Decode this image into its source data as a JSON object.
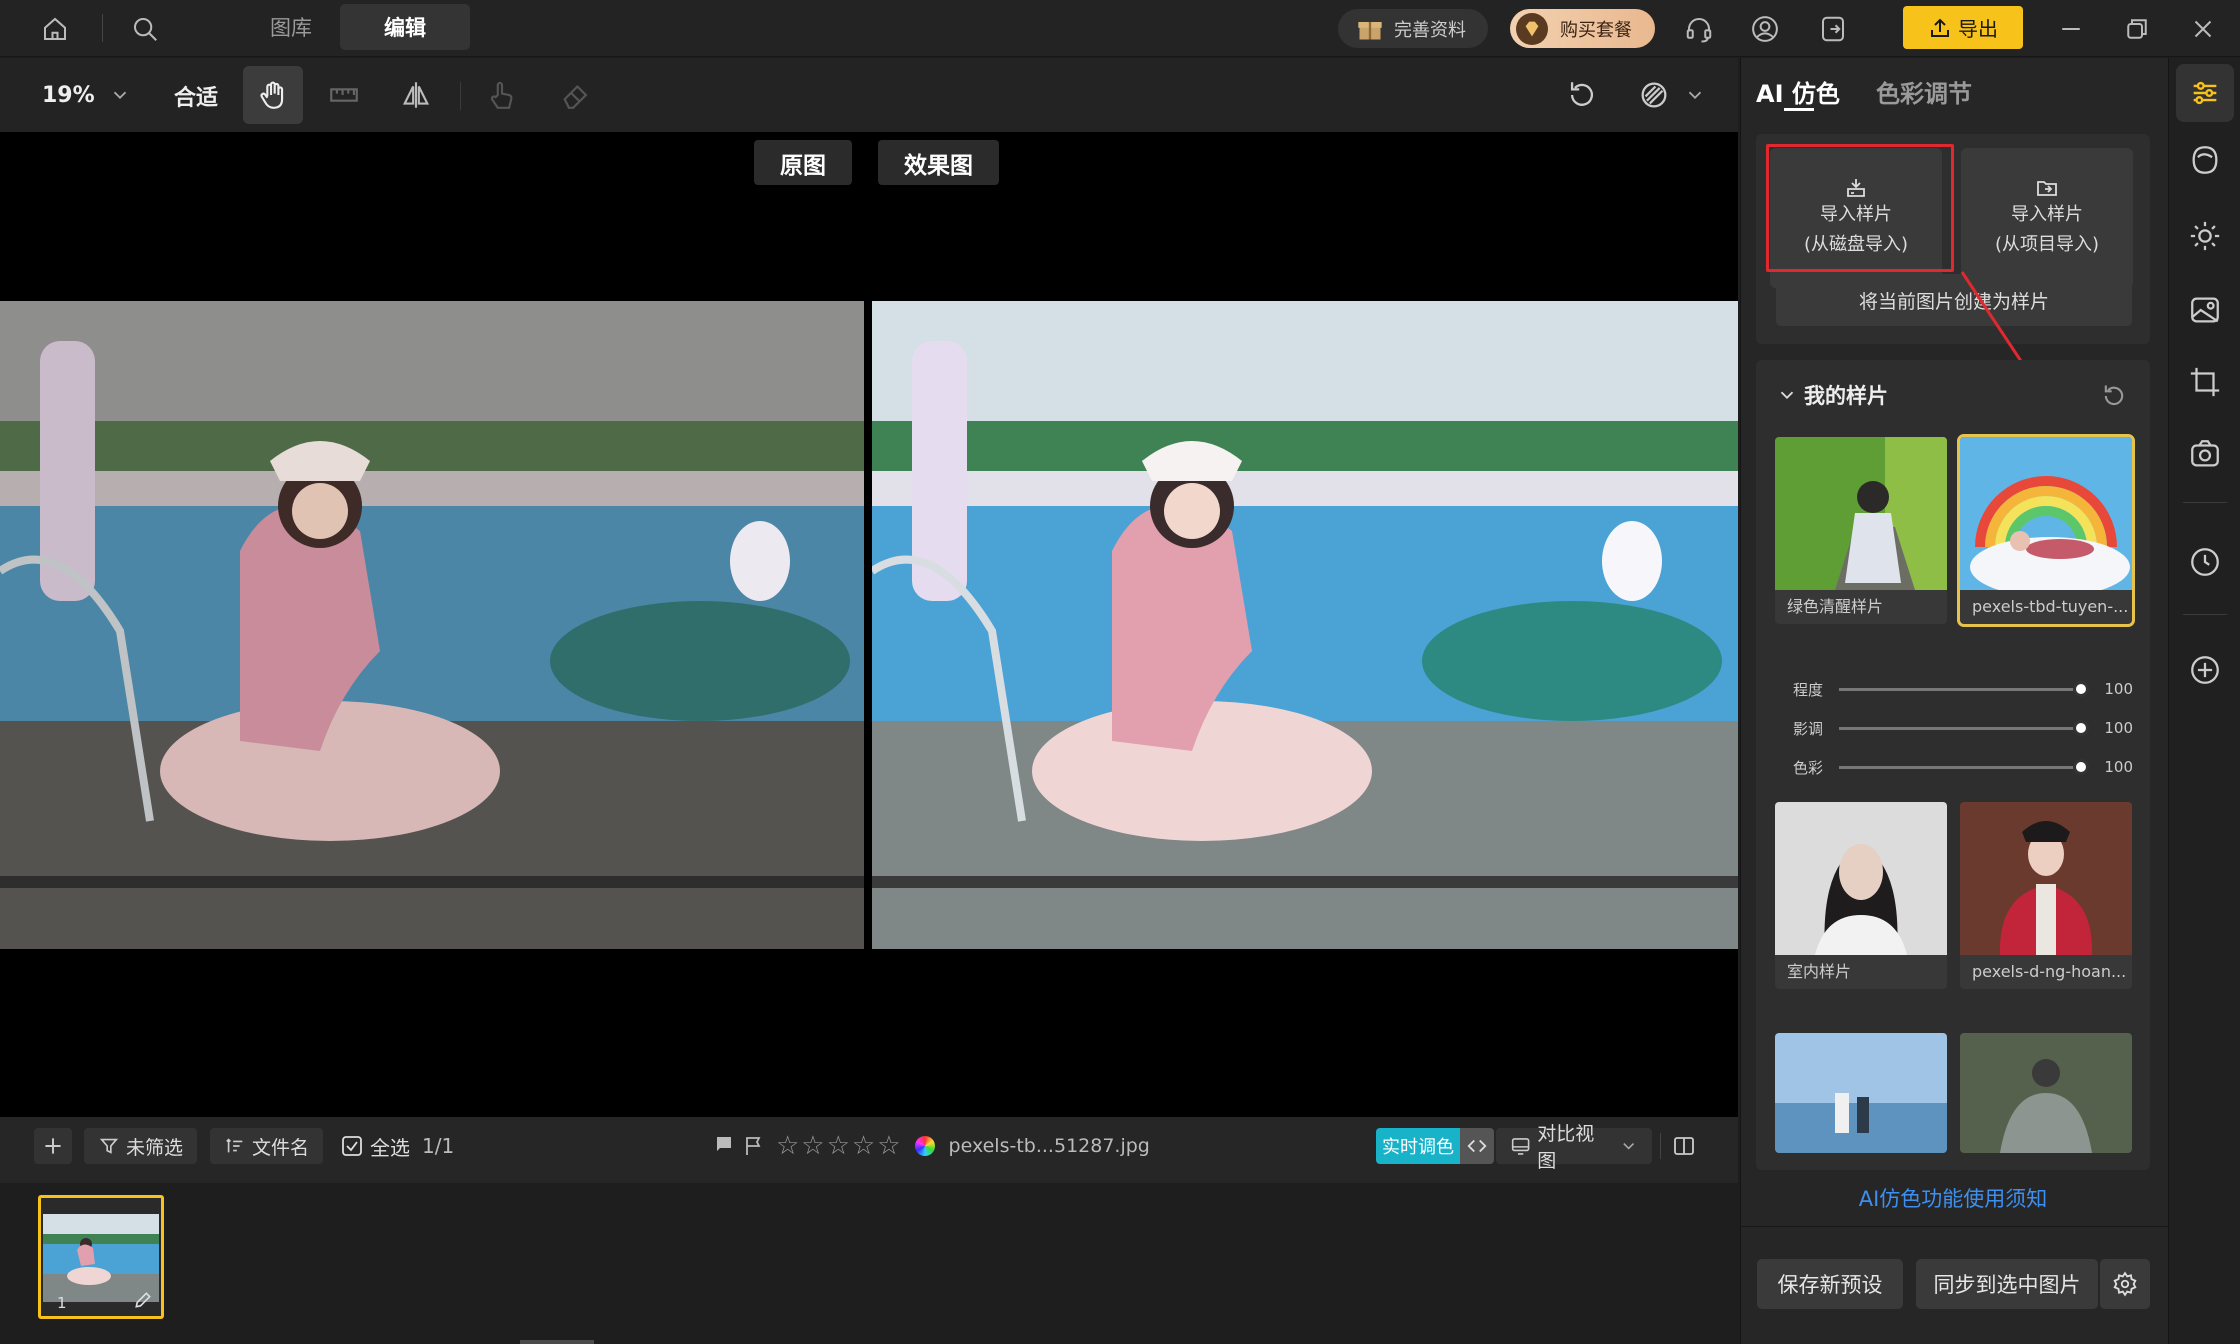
{
  "titlebar": {
    "tabs": [
      {
        "label": "图库",
        "active": false
      },
      {
        "label": "编辑",
        "active": true
      }
    ],
    "complete_profile": "完善资料",
    "buy_package": "购买套餐",
    "export": "导出",
    "icons": [
      "home-icon",
      "search-icon",
      "headset-icon",
      "user-icon",
      "logout-icon",
      "upload-icon",
      "minimize-icon",
      "restore-icon",
      "close-icon"
    ]
  },
  "toolbar": {
    "zoom": "19%",
    "fit": "合适",
    "tools": [
      "hand-icon",
      "ruler-icon",
      "flip-icon",
      "touch-icon",
      "eraser-icon"
    ]
  },
  "canvas": {
    "original_label": "原图",
    "effect_label": "效果图"
  },
  "filmbar": {
    "filter": "未筛选",
    "sort": "文件名",
    "select_all": "全选",
    "count": "1/1",
    "filename": "pexels-tb...51287.jpg",
    "realtime": "实时调色",
    "compare_view": "对比视图",
    "stars": 0
  },
  "strip": {
    "index": "1"
  },
  "panel": {
    "tabs": [
      {
        "label": "AI 仿色",
        "active": true
      },
      {
        "label": "色彩调节",
        "active": false
      }
    ],
    "import_disk_line1": "导入样片",
    "import_disk_line2": "(从磁盘导入)",
    "import_project_line1": "导入样片",
    "import_project_line2": "(从项目导入)",
    "create_sample": "将当前图片创建为样片",
    "my_samples": "我的样片",
    "samples": [
      {
        "label": "绿色清醒样片",
        "selected": false
      },
      {
        "label": "pexels-tbd-tuyen-...",
        "selected": true
      },
      {
        "label": "室内样片",
        "selected": false
      },
      {
        "label": "pexels-d-ng-hoan...",
        "selected": false
      },
      {
        "label": "",
        "selected": false
      },
      {
        "label": "",
        "selected": false
      }
    ],
    "sliders": [
      {
        "label": "程度",
        "value": "100"
      },
      {
        "label": "影调",
        "value": "100"
      },
      {
        "label": "色彩",
        "value": "100"
      }
    ],
    "help_link": "AI仿色功能使用须知",
    "save_preset": "保存新预设",
    "sync": "同步到选中图片"
  },
  "colors": {
    "accent_yellow": "#f7c21a",
    "highlight_red": "#e0292f",
    "link_blue": "#3d8ff0",
    "realtime_cyan": "#19b3c9"
  }
}
